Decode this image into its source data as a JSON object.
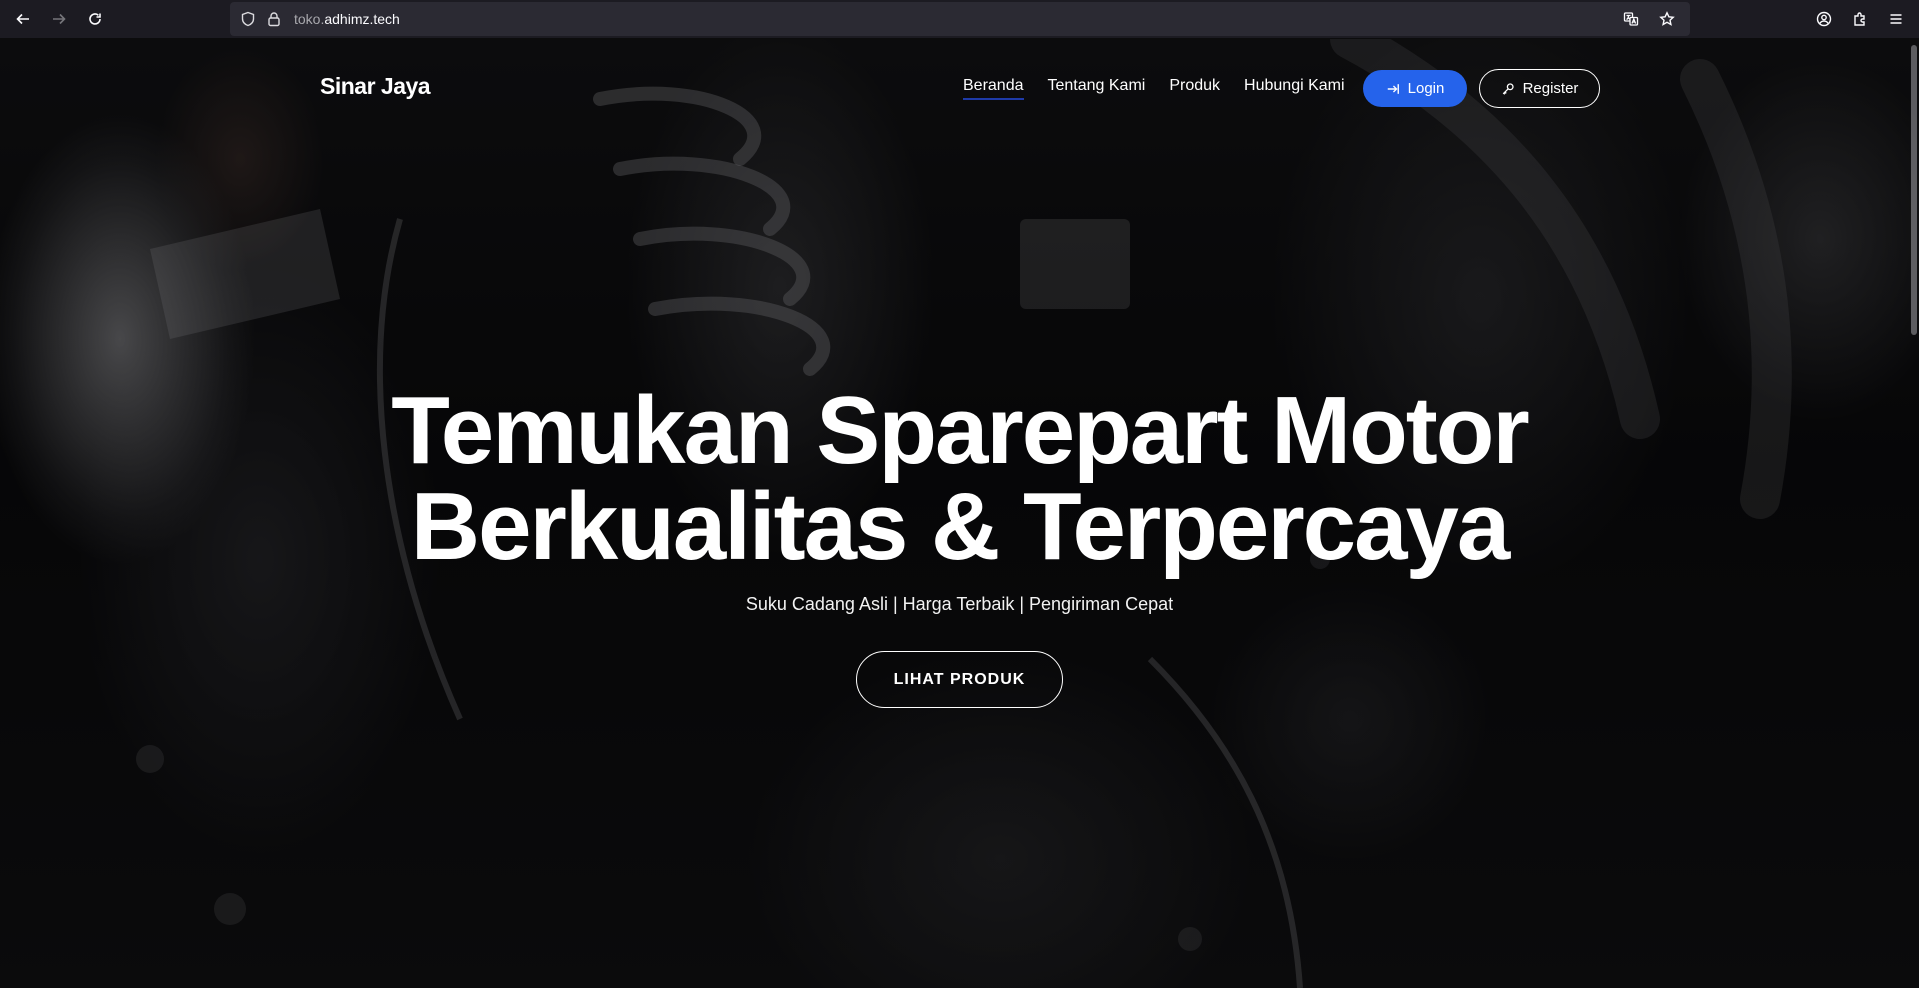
{
  "browser": {
    "url_host_dim": "toko.",
    "url_host": "adhimz.tech",
    "icons": [
      "back-icon",
      "forward-icon",
      "reload-icon",
      "shield-icon",
      "lock-icon",
      "translate-icon",
      "star-icon",
      "account-icon",
      "extensions-icon",
      "menu-icon"
    ]
  },
  "nav": {
    "brand": "Sinar Jaya",
    "items": [
      {
        "label": "Beranda",
        "active": true
      },
      {
        "label": "Tentang Kami",
        "active": false
      },
      {
        "label": "Produk",
        "active": false
      },
      {
        "label": "Hubungi Kami",
        "active": false
      }
    ],
    "login_label": "Login",
    "register_label": "Register"
  },
  "hero": {
    "title_line1": "Temukan Sparepart Motor",
    "title_line2": "Berkualitas & Terpercaya",
    "subtitle": "Suku Cadang Asli | Harga Terbaik | Pengiriman Cepat",
    "cta_label": "LIHAT PRODUK"
  },
  "colors": {
    "accent": "#2563eb",
    "active_underline": "#1e3aa8",
    "chrome_bg": "#1c1b22",
    "urlbar_bg": "#2b2a33"
  }
}
